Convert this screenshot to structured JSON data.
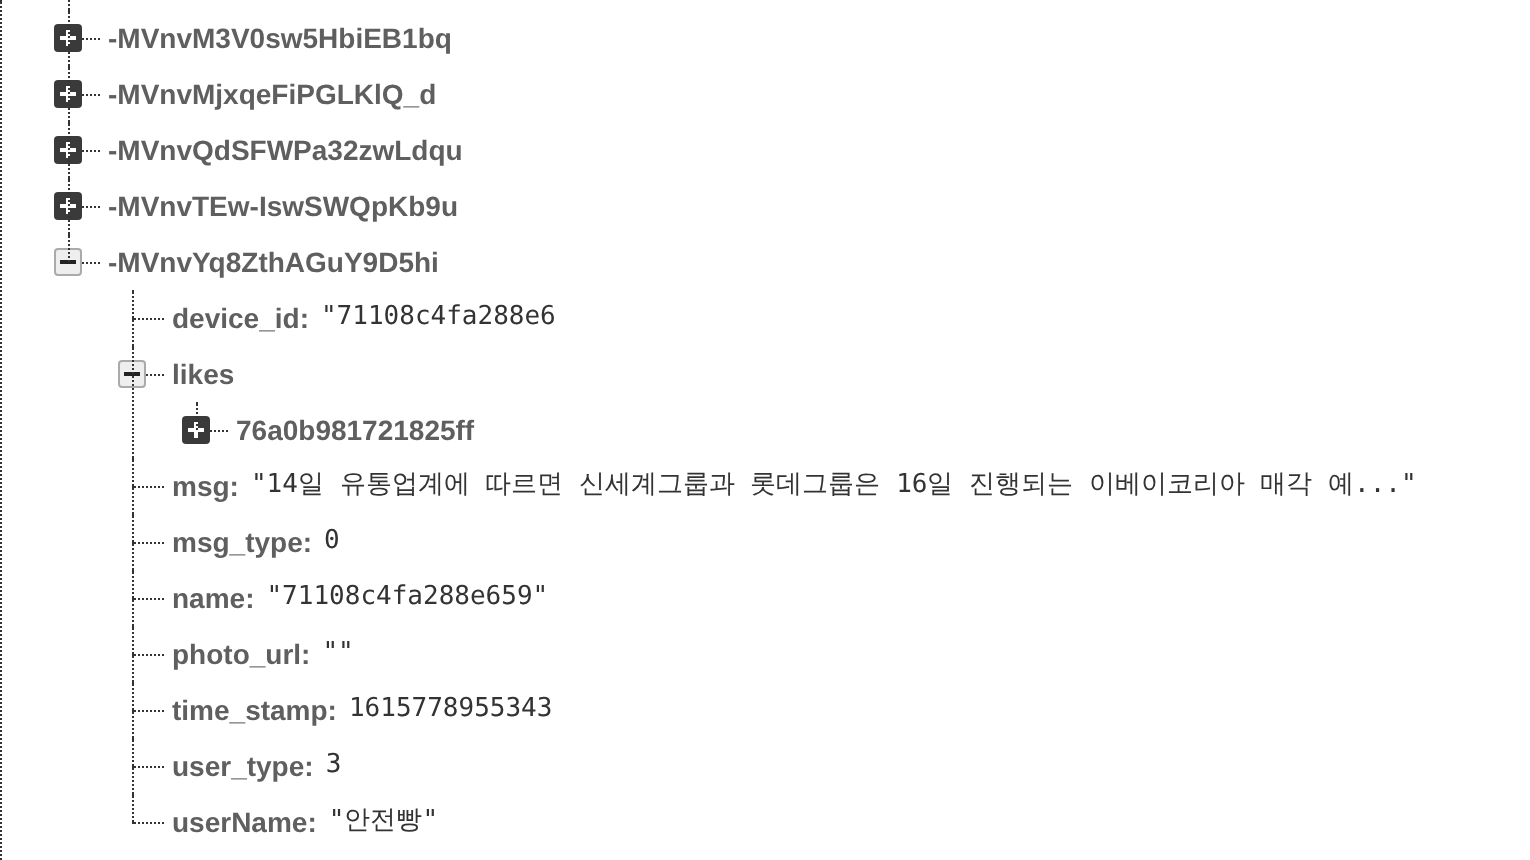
{
  "nodes": [
    {
      "key": "-MVnvM3V0sw5HbiEB1bq",
      "expanded": false
    },
    {
      "key": "-MVnvMjxqeFiPGLKlQ_d",
      "expanded": false
    },
    {
      "key": "-MVnvQdSFWPa32zwLdqu",
      "expanded": false
    },
    {
      "key": "-MVnvTEw-IswSWQpKb9u",
      "expanded": false
    },
    {
      "key": "-MVnvYq8ZthAGuY9D5hi",
      "expanded": true,
      "children": [
        {
          "key": "device_id:",
          "value": "\"71108c4fa288e6"
        },
        {
          "key": "likes",
          "expanded": true,
          "children": [
            {
              "key": "76a0b981721825ff",
              "expanded": false
            }
          ]
        },
        {
          "key": "msg:",
          "value": "\"14일 유통업계에 따르면 신세계그룹과 롯데그룹은 16일 진행되는 이베이코리아 매각 예...\""
        },
        {
          "key": "msg_type:",
          "value": "0"
        },
        {
          "key": "name:",
          "value": "\"71108c4fa288e659\""
        },
        {
          "key": "photo_url:",
          "value": "\"\""
        },
        {
          "key": "time_stamp:",
          "value": "1615778955343"
        },
        {
          "key": "user_type:",
          "value": "3"
        },
        {
          "key": "userName:",
          "value": "\"안전빵\""
        }
      ]
    }
  ]
}
